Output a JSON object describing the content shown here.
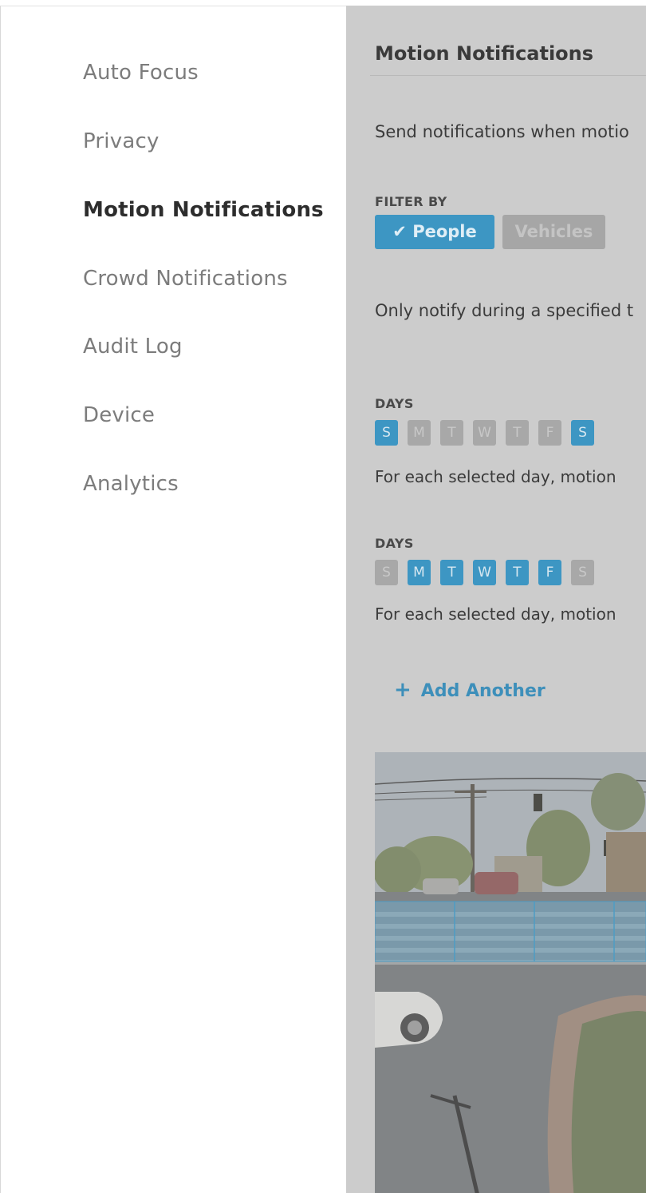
{
  "sidebar": {
    "items": [
      {
        "label": "Auto Focus"
      },
      {
        "label": "Privacy"
      },
      {
        "label": "Motion Notifications",
        "active": true
      },
      {
        "label": "Crowd Notifications"
      },
      {
        "label": "Audit Log"
      },
      {
        "label": "Device"
      },
      {
        "label": "Analytics"
      }
    ]
  },
  "main": {
    "title": "Motion Notifications",
    "description": "Send notifications when motio",
    "filter": {
      "caption": "FILTER BY",
      "options": [
        {
          "label": "People",
          "checked": true,
          "icon": "check-icon"
        },
        {
          "label": "Vehicles",
          "checked": false
        }
      ]
    },
    "schedule_intro": "Only notify during a specified t",
    "schedules": [
      {
        "caption": "DAYS",
        "days": [
          {
            "label": "S",
            "selected": true
          },
          {
            "label": "M",
            "selected": false
          },
          {
            "label": "T",
            "selected": false
          },
          {
            "label": "W",
            "selected": false
          },
          {
            "label": "T",
            "selected": false
          },
          {
            "label": "F",
            "selected": false
          },
          {
            "label": "S",
            "selected": true
          }
        ],
        "note": "For each selected day, motion"
      },
      {
        "caption": "DAYS",
        "days": [
          {
            "label": "S",
            "selected": false
          },
          {
            "label": "M",
            "selected": true
          },
          {
            "label": "T",
            "selected": true
          },
          {
            "label": "W",
            "selected": true
          },
          {
            "label": "T",
            "selected": true
          },
          {
            "label": "F",
            "selected": true
          },
          {
            "label": "S",
            "selected": false
          }
        ],
        "note": "For each selected day, motion"
      }
    ],
    "add_another": {
      "icon": "plus-icon",
      "label": "Add Another"
    }
  },
  "colors": {
    "accent": "#3d96c3",
    "overlay_bg": "#cccccc",
    "inactive_chip": "#a6a6a6",
    "text_active": "#2d2d2d",
    "text_inactive": "#7c7c7c"
  }
}
